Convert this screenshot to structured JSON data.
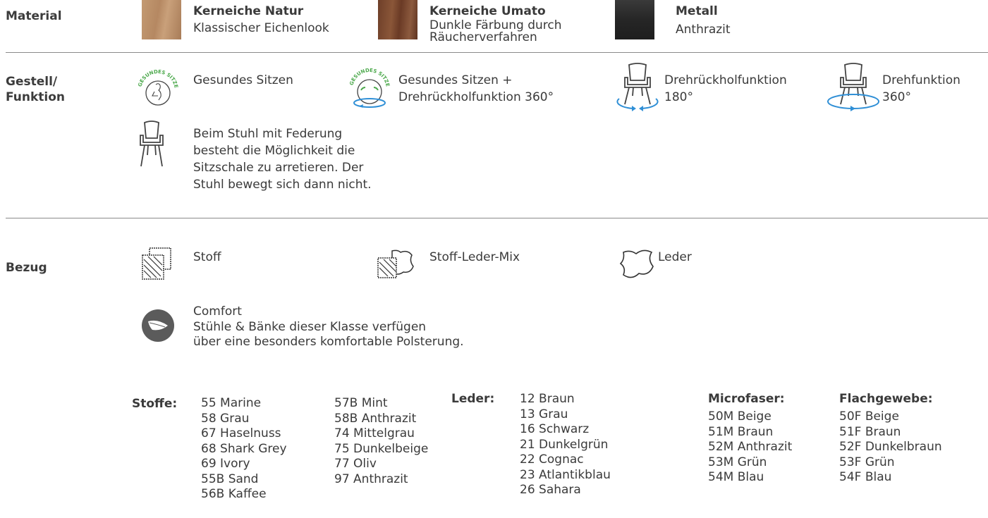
{
  "material": {
    "label": "Material",
    "items": [
      {
        "name": "Kerneiche Natur",
        "desc": "Klassischer Eichenlook",
        "swatch": "#b88a63"
      },
      {
        "name": "Kerneiche Umato",
        "desc1": "Dunkle Färbung durch",
        "desc2": "Räucherverfahren",
        "swatch": "#7a4a32"
      },
      {
        "name": "Metall",
        "desc": "Anthrazit",
        "swatch": "#2e2e2e"
      }
    ]
  },
  "gestell": {
    "label1": "Gestell/",
    "label2": "Funktion",
    "gesund": {
      "text": "Gesundes Sitzen",
      "icon_text": "GESUNDES SITZEN"
    },
    "gesund_dreh": {
      "line1": "Gesundes Sitzen +",
      "line2": "Drehrückholfunktion 360°",
      "icon_text": "GESUNDES SITZEN"
    },
    "dreh180": {
      "line1": "Drehrückholfunktion",
      "line2": "180°"
    },
    "dreh360": {
      "line1": "Drehfunktion",
      "line2": "360°"
    },
    "feder": {
      "line1": "Beim Stuhl mit Federung",
      "line2": "besteht die Möglichkeit die",
      "line3": "Sitzschale zu arretieren. Der",
      "line4": "Stuhl bewegt sich dann nicht."
    }
  },
  "bezug": {
    "label": "Bezug",
    "stoff": "Stoff",
    "mix": "Stoff-Leder-Mix",
    "leder": "Leder",
    "comfort": {
      "title": "Comfort",
      "line1": "Stühle & Bänke dieser Klasse verfügen",
      "line2": "über eine besonders komfortable Polsterung."
    }
  },
  "colors": {
    "stoffe_label": "Stoffe:",
    "stoffe_col1": [
      "55 Marine",
      "58 Grau",
      "67 Haselnuss",
      "68 Shark Grey",
      "69 Ivory",
      "55B Sand",
      "56B Kaffee"
    ],
    "stoffe_col2": [
      "57B Mint",
      "58B Anthrazit",
      "74 Mittelgrau",
      "75 Dunkelbeige",
      "77 Oliv",
      "97 Anthrazit"
    ],
    "leder_label": "Leder:",
    "leder": [
      "12 Braun",
      "13 Grau",
      "16 Schwarz",
      "21 Dunkelgrün",
      "22 Cognac",
      "23 Atlantikblau",
      "26 Sahara"
    ],
    "micro_label": "Microfaser:",
    "micro": [
      "50M Beige",
      "51M Braun",
      "52M Anthrazit",
      "53M Grün",
      "54M Blau"
    ],
    "flach_label": "Flachgewebe:",
    "flach": [
      "50F Beige",
      "51F Braun",
      "52F Dunkelbraun",
      "53F Grün",
      "54F Blau"
    ]
  },
  "accent": {
    "green": "#4aa84a",
    "blue": "#2f8fd6",
    "grey_circle": "#5b5b5b"
  }
}
